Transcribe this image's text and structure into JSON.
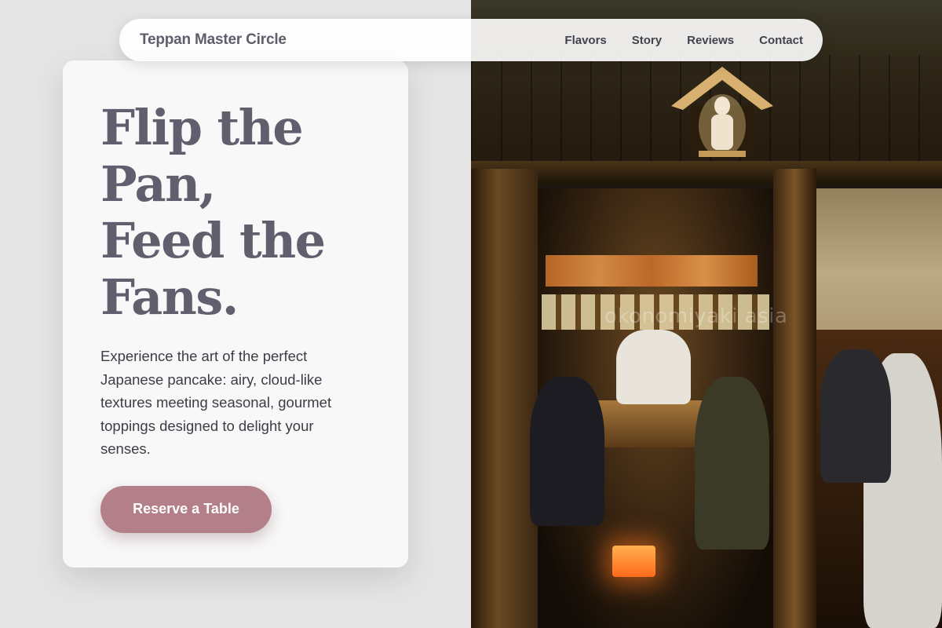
{
  "nav": {
    "brand": "Teppan Master Circle",
    "links": [
      "Flavors",
      "Story",
      "Reviews",
      "Contact"
    ]
  },
  "hero": {
    "headline_lines": [
      "Flip the",
      "Pan,",
      "Feed the",
      "Fans."
    ],
    "lead": "Experience the art of the perfect Japanese pancake: airy, cloud-like textures meeting seasonal, gourmet toppings designed to delight your senses.",
    "cta_label": "Reserve a Table"
  },
  "photo": {
    "alt": "Okonomiyaki restaurant interior at night",
    "watermark": "okonomiyaki asia"
  },
  "colors": {
    "page_bg": "#e5e5e6",
    "headline": "#615e6e",
    "cta_bg": "#b37f88",
    "card_bg": "#f8f8f8"
  }
}
